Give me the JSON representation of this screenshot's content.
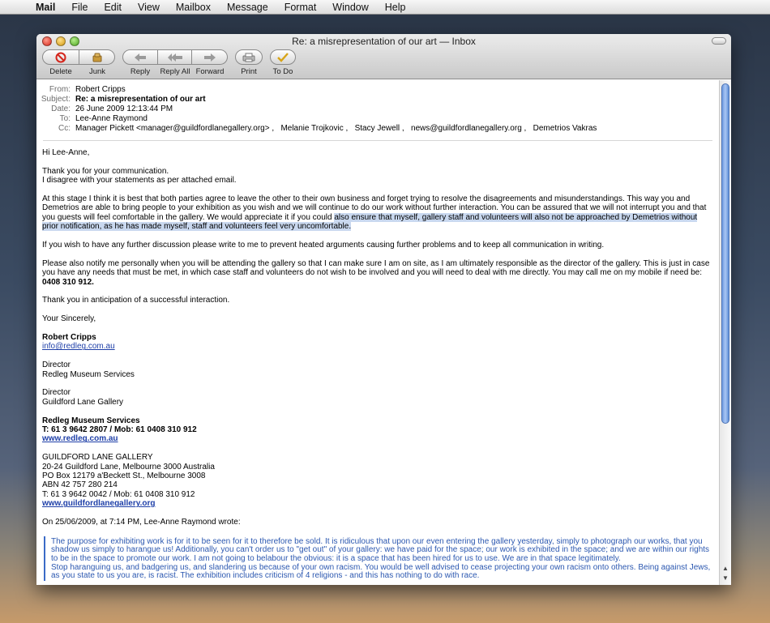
{
  "menubar": {
    "apple": "",
    "items": [
      "Mail",
      "File",
      "Edit",
      "View",
      "Mailbox",
      "Message",
      "Format",
      "Window",
      "Help"
    ]
  },
  "window": {
    "title": "Re: a misrepresentation of our art — Inbox"
  },
  "toolbar": {
    "delete": "Delete",
    "junk": "Junk",
    "reply": "Reply",
    "reply_all": "Reply All",
    "forward": "Forward",
    "print": "Print",
    "todo": "To Do"
  },
  "headers": {
    "from_label": "From:",
    "from": "Robert Cripps",
    "subject_label": "Subject:",
    "subject": "Re: a misrepresentation of our art",
    "date_label": "Date:",
    "date": "26 June 2009 12:13:44 PM",
    "to_label": "To:",
    "to": "Lee-Anne Raymond",
    "cc_label": "Cc:",
    "cc": "Manager Pickett <manager@guildfordlanegallery.org> ,   Melanie Trojkovic ,   Stacy Jewell ,   news@guildfordlanegallery.org ,   Demetrios Vakras"
  },
  "body": {
    "greeting": "Hi Lee-Anne,",
    "p1a": "Thank you for your communication.",
    "p1b": "I disagree with your statements as per attached email.",
    "p2a": "At this stage I think it is best that both parties agree to leave the other to their own business and forget trying to resolve the disagreements and misunderstandings. This way you and Demetrios are able to bring people to your exhibition as you wish and we will continue to do our work without further interaction. You can be assured that we will not interrupt you and that you guests will feel comfortable in the gallery. We would appreciate it if you could ",
    "p2b": "also ensure that myself, gallery staff and volunteers will also not be approached by Demetrios without prior notification, as he has made myself, staff and volunteers feel very uncomfortable.",
    "p3": "If you wish to have any further discussion please write to me to prevent heated arguments causing further problems and to keep all communication in writing.",
    "p4a": "Please also notify me personally when you will be attending the gallery so that I can make sure I am on site, as I am ultimately responsible as the director of the gallery. This is just in case you have any needs that must be met, in which case staff and volunteers do not wish to be involved and you will need to deal with me directly. You may call me on my mobile if need be: ",
    "p4b": "0408 310 912.",
    "p5": "Thank you in anticipation of a successful interaction.",
    "closing": "Your Sincerely,",
    "sig_name": "Robert Cripps",
    "sig_email": "info@redleg.com.au",
    "sig_title1": "Director",
    "sig_org1": "Redleg Museum Services",
    "sig_title2": "Director",
    "sig_org2": "Guildford Lane Gallery",
    "rms_name": "Redleg Museum Services",
    "rms_phone": "T: 61 3 9642 2807 / Mob: 61 0408 310 912",
    "rms_web": "www.redleg.com.au",
    "glg_name": "GUILDFORD LANE GALLERY",
    "glg_addr1": "20-24 Guildford Lane, Melbourne 3000 Australia",
    "glg_addr2": "PO Box 12179 a'Beckett St., Melbourne 3008",
    "glg_abn": "ABN 42 757 280 214",
    "glg_phone": "T: 61 3 9642 0042 / Mob: 61 0408 310 912",
    "glg_web": "www.guildfordlanegallery.org",
    "wrote": "On 25/06/2009, at 7:14 PM, Lee-Anne Raymond wrote:",
    "quote1": "The purpose for exhibiting work is for it to be seen for it to therefore be sold. It is ridiculous that upon our even entering the gallery yesterday, simply to photograph our works, that you shadow us simply to harangue us! Additionally, you can't order us to \"get out\" of your gallery: we have paid for the space; our work is exhibited in the space; and we are within our rights to be in the space to promote our work. I am not going to belabour the obvious: it is a space that has been hired for us to use. We are in that space legitimately.",
    "quote2": "Stop haranguing us, and badgering us, and slandering us because of your own racism. You would be well advised to cease projecting your own racism onto others. Being against Jews, as you state to us you are, is racist. The exhibition includes criticism of 4 religions - and this has nothing to do with race."
  },
  "colors": {
    "link": "#1e3fa8",
    "quote": "#2c58b0",
    "highlight": "#c9d8ef"
  }
}
